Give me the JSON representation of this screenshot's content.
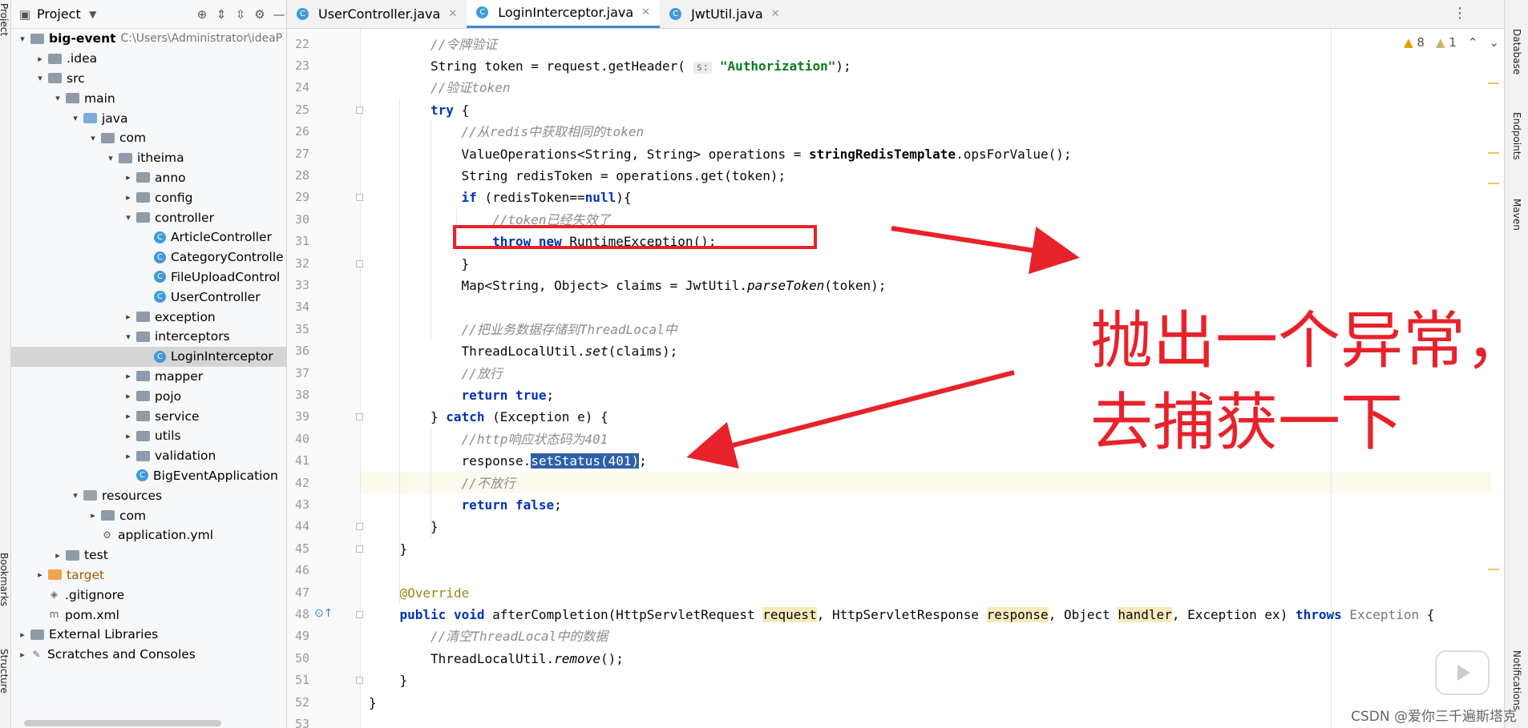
{
  "left_strip": {
    "project_label": "Project",
    "bookmarks_label": "Bookmarks",
    "structure_label": "Structure"
  },
  "project_panel": {
    "title": "Project",
    "tree": [
      {
        "label": "big-event",
        "path": "C:\\Users\\Administrator\\ideaP",
        "indent": 0,
        "chev": "v",
        "icon": "module"
      },
      {
        "label": ".idea",
        "indent": 1,
        "chev": ">",
        "icon": "folder"
      },
      {
        "label": "src",
        "indent": 1,
        "chev": "v",
        "icon": "folder"
      },
      {
        "label": "main",
        "indent": 2,
        "chev": "v",
        "icon": "folder"
      },
      {
        "label": "java",
        "indent": 3,
        "chev": "v",
        "icon": "src"
      },
      {
        "label": "com",
        "indent": 4,
        "chev": "v",
        "icon": "folder"
      },
      {
        "label": "itheima",
        "indent": 5,
        "chev": "v",
        "icon": "folder"
      },
      {
        "label": "anno",
        "indent": 6,
        "chev": ">",
        "icon": "folder"
      },
      {
        "label": "config",
        "indent": 6,
        "chev": ">",
        "icon": "folder"
      },
      {
        "label": "controller",
        "indent": 6,
        "chev": "v",
        "icon": "folder"
      },
      {
        "label": "ArticleController",
        "indent": 7,
        "chev": "",
        "icon": "class"
      },
      {
        "label": "CategoryControlle",
        "indent": 7,
        "chev": "",
        "icon": "class"
      },
      {
        "label": "FileUploadControl",
        "indent": 7,
        "chev": "",
        "icon": "class"
      },
      {
        "label": "UserController",
        "indent": 7,
        "chev": "",
        "icon": "class"
      },
      {
        "label": "exception",
        "indent": 6,
        "chev": ">",
        "icon": "folder"
      },
      {
        "label": "interceptors",
        "indent": 6,
        "chev": "v",
        "icon": "folder"
      },
      {
        "label": "LoginInterceptor",
        "indent": 7,
        "chev": "",
        "icon": "class",
        "selected": true
      },
      {
        "label": "mapper",
        "indent": 6,
        "chev": ">",
        "icon": "folder"
      },
      {
        "label": "pojo",
        "indent": 6,
        "chev": ">",
        "icon": "folder"
      },
      {
        "label": "service",
        "indent": 6,
        "chev": ">",
        "icon": "folder"
      },
      {
        "label": "utils",
        "indent": 6,
        "chev": ">",
        "icon": "folder"
      },
      {
        "label": "validation",
        "indent": 6,
        "chev": ">",
        "icon": "folder"
      },
      {
        "label": "BigEventApplication",
        "indent": 6,
        "chev": "",
        "icon": "app"
      },
      {
        "label": "resources",
        "indent": 3,
        "chev": "v",
        "icon": "res"
      },
      {
        "label": "com",
        "indent": 4,
        "chev": ">",
        "icon": "folder"
      },
      {
        "label": "application.yml",
        "indent": 4,
        "chev": "",
        "icon": "yml"
      },
      {
        "label": "test",
        "indent": 2,
        "chev": ">",
        "icon": "folder"
      },
      {
        "label": "target",
        "indent": 1,
        "chev": ">",
        "icon": "orange"
      },
      {
        "label": ".gitignore",
        "indent": 1,
        "chev": "",
        "icon": "git"
      },
      {
        "label": "pom.xml",
        "indent": 1,
        "chev": "",
        "icon": "maven"
      },
      {
        "label": "External Libraries",
        "indent": 0,
        "chev": ">",
        "icon": "lib"
      },
      {
        "label": "Scratches and Consoles",
        "indent": 0,
        "chev": ">",
        "icon": "scratch"
      }
    ]
  },
  "tabs": [
    {
      "label": "UserController.java",
      "active": false
    },
    {
      "label": "LoginInterceptor.java",
      "active": true
    },
    {
      "label": "JwtUtil.java",
      "active": false
    }
  ],
  "inspection": {
    "warnings": "8",
    "weak": "1"
  },
  "right_strip": {
    "database": "Database",
    "endpoints": "Endpoints",
    "maven": "Maven",
    "notifications": "Notifications"
  },
  "editor": {
    "first_line": 22,
    "lines": [
      {
        "n": 22,
        "indent": 8,
        "html": "<span class=\"cm\">//令牌验证</span>"
      },
      {
        "n": 23,
        "indent": 8,
        "html": "String token = request.getHeader( <span class=\"hint\">s:</span> <span class=\"st\">\"Authorization\"</span>);"
      },
      {
        "n": 24,
        "indent": 8,
        "html": "<span class=\"cm\">//验证token</span>"
      },
      {
        "n": 25,
        "indent": 8,
        "html": "<span class=\"kw\">try</span> {"
      },
      {
        "n": 26,
        "indent": 12,
        "html": "<span class=\"cm\">//从redis中获取相同的token</span>"
      },
      {
        "n": 27,
        "indent": 12,
        "html": "ValueOperations&lt;String, String&gt; operations = <b>stringRedisTemplate</b>.opsForValue();"
      },
      {
        "n": 28,
        "indent": 12,
        "html": "String redisToken = operations.get(token);"
      },
      {
        "n": 29,
        "indent": 12,
        "html": "<span class=\"kw\">if</span> (redisToken==<span class=\"kw\">null</span>){"
      },
      {
        "n": 30,
        "indent": 16,
        "html": "<span class=\"cm\">//token已经失效了</span>"
      },
      {
        "n": 31,
        "indent": 16,
        "html": "<span class=\"kw\">throw new</span> RuntimeException();"
      },
      {
        "n": 32,
        "indent": 12,
        "html": "}"
      },
      {
        "n": 33,
        "indent": 12,
        "html": "Map&lt;String, Object&gt; claims = JwtUtil.<span class=\"fn\">parseToken</span>(token);"
      },
      {
        "n": 34,
        "indent": 0,
        "html": ""
      },
      {
        "n": 35,
        "indent": 12,
        "html": "<span class=\"cm\">//把业务数据存储到ThreadLocal中</span>"
      },
      {
        "n": 36,
        "indent": 12,
        "html": "ThreadLocalUtil.<span class=\"fn\">set</span>(claims);"
      },
      {
        "n": 37,
        "indent": 12,
        "html": "<span class=\"cm\">//放行</span>"
      },
      {
        "n": 38,
        "indent": 12,
        "html": "<span class=\"kw\">return true</span>;"
      },
      {
        "n": 39,
        "indent": 8,
        "html": "} <span class=\"kw\">catch</span> (Exception e) {"
      },
      {
        "n": 40,
        "indent": 12,
        "html": "<span class=\"cm\">//http响应状态码为401</span>"
      },
      {
        "n": 41,
        "indent": 12,
        "html": "response.<span class=\"sel\">setStatus(401)</span>;"
      },
      {
        "n": 42,
        "indent": 12,
        "html": "<span class=\"cm\">//不放行</span>"
      },
      {
        "n": 43,
        "indent": 12,
        "html": "<span class=\"kw\">return false</span>;"
      },
      {
        "n": 44,
        "indent": 8,
        "html": "}"
      },
      {
        "n": 45,
        "indent": 4,
        "html": "}"
      },
      {
        "n": 46,
        "indent": 0,
        "html": ""
      },
      {
        "n": 47,
        "indent": 4,
        "html": "<span class=\"an\">@Override</span>"
      },
      {
        "n": 48,
        "indent": 4,
        "html": "<span class=\"kw\">public void</span> afterCompletion(HttpServletRequest <span class=\"hl\">request</span>, HttpServletResponse <span class=\"hl\">response</span>, Object <span class=\"hl\">handler</span>, Exception ex) <span class=\"kw\">throws</span> <span style=\"color:#777\">Exception</span> {"
      },
      {
        "n": 49,
        "indent": 8,
        "html": "<span class=\"cm\">//清空ThreadLocal中的数据</span>"
      },
      {
        "n": 50,
        "indent": 8,
        "html": "ThreadLocalUtil.<span class=\"fn\">remove</span>();"
      },
      {
        "n": 51,
        "indent": 4,
        "html": "}"
      },
      {
        "n": 52,
        "indent": 0,
        "html": "}"
      },
      {
        "n": 53,
        "indent": 0,
        "html": ""
      }
    ]
  },
  "annotation": {
    "line1": "抛出一个异常，",
    "line2": "去捕获一下",
    "color": "#e8222a"
  },
  "watermark": "CSDN @爱你三千遍斯塔克"
}
